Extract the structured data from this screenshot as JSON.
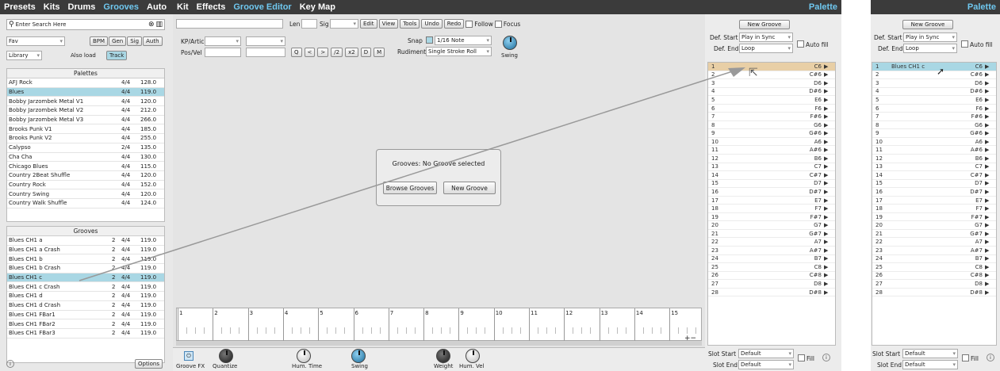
{
  "left_tabs": [
    "Presets",
    "Kits",
    "Drums",
    "Grooves",
    "Auto"
  ],
  "center_tabs": [
    "Kit",
    "Effects",
    "Groove Editor",
    "Key Map"
  ],
  "palette_title": "Palette",
  "search": {
    "placeholder": "Enter Search Here"
  },
  "filter": {
    "fav": "Fav",
    "bpm": "BPM",
    "gen": "Gen",
    "sig": "Sig",
    "auth": "Auth",
    "library": "Library",
    "also_load": "Also load",
    "track": "Track"
  },
  "palettes": {
    "title": "Palettes",
    "rows": [
      [
        "AFJ Rock",
        "4/4",
        "128.0"
      ],
      [
        "Blues",
        "4/4",
        "119.0"
      ],
      [
        "Bobby Jarzombek Metal V1",
        "4/4",
        "120.0"
      ],
      [
        "Bobby Jarzombek Metal V2",
        "4/4",
        "212.0"
      ],
      [
        "Bobby Jarzombek Metal V3",
        "4/4",
        "266.0"
      ],
      [
        "Brooks Punk V1",
        "4/4",
        "185.0"
      ],
      [
        "Brooks Punk V2",
        "4/4",
        "255.0"
      ],
      [
        "Calypso",
        "2/4",
        "135.0"
      ],
      [
        "Cha Cha",
        "4/4",
        "130.0"
      ],
      [
        "Chicago Blues",
        "4/4",
        "115.0"
      ],
      [
        "Country 2Beat Shuffle",
        "4/4",
        "120.0"
      ],
      [
        "Country Rock",
        "4/4",
        "152.0"
      ],
      [
        "Country Swing",
        "4/4",
        "120.0"
      ],
      [
        "Country Walk Shuffle",
        "4/4",
        "124.0"
      ]
    ]
  },
  "grooves": {
    "title": "Grooves",
    "rows": [
      [
        "Blues CH1 a",
        "2",
        "4/4",
        "119.0"
      ],
      [
        "Blues CH1 a Crash",
        "2",
        "4/4",
        "119.0"
      ],
      [
        "Blues CH1 b",
        "2",
        "4/4",
        "119.0"
      ],
      [
        "Blues CH1 b Crash",
        "2",
        "4/4",
        "119.0"
      ],
      [
        "Blues CH1 c",
        "2",
        "4/4",
        "119.0"
      ],
      [
        "Blues CH1 c Crash",
        "2",
        "4/4",
        "119.0"
      ],
      [
        "Blues CH1 d",
        "2",
        "4/4",
        "119.0"
      ],
      [
        "Blues CH1 d Crash",
        "2",
        "4/4",
        "119.0"
      ],
      [
        "Blues CH1 FBar1",
        "2",
        "4/4",
        "119.0"
      ],
      [
        "Blues CH1 FBar2",
        "2",
        "4/4",
        "119.0"
      ],
      [
        "Blues CH1 FBar3",
        "2",
        "4/4",
        "119.0"
      ]
    ]
  },
  "options": "Options",
  "editor": {
    "len": "Len",
    "sig": "Sig",
    "edit": "Edit",
    "view": "View",
    "tools": "Tools",
    "undo": "Undo",
    "redo": "Redo",
    "follow": "Follow",
    "focus": "Focus",
    "kp_artic": "KP/Artic",
    "pos_vel": "Pos/Vel",
    "q": "Q",
    "lt": "<",
    ">gt": ">",
    "div2": "/2",
    "x2": "x2",
    "d": "D",
    "m": "M",
    "snap": "Snap",
    "snap_value": "1/16 Note",
    "rudiment": "Rudiment",
    "rudiment_value": "Single Stroke Roll",
    "swing": "Swing"
  },
  "dialog": {
    "message": "Grooves: No Groove selected",
    "browse": "Browse Grooves",
    "new": "New Groove"
  },
  "ruler": [
    "1",
    "2",
    "3",
    "4",
    "5",
    "6",
    "7",
    "8",
    "9",
    "10",
    "11",
    "12",
    "13",
    "14",
    "15"
  ],
  "bottom_knobs": {
    "groove_fx": "Groove FX",
    "quantize": "Quantize",
    "hum_time": "Hum. Time",
    "swing": "Swing",
    "weight": "Weight",
    "hum_vel": "Hum. Vel"
  },
  "palette_panel": {
    "new_groove": "New Groove",
    "def_start": "Def. Start",
    "def_start_value": "Play in Sync",
    "def_end": "Def. End",
    "def_end_value": "Loop",
    "auto_fill": "Auto fill",
    "slot_start": "Slot Start",
    "slot_start_value": "Default",
    "slot_end": "Slot End",
    "slot_end_value": "Default",
    "fill": "Fill"
  },
  "slot_label_right": "Blues CH1 c",
  "notes": [
    "C6",
    "C#6",
    "D6",
    "D#6",
    "E6",
    "F6",
    "F#6",
    "G6",
    "G#6",
    "A6",
    "A#6",
    "B6",
    "C7",
    "C#7",
    "D7",
    "D#7",
    "E7",
    "F7",
    "F#7",
    "G7",
    "G#7",
    "A7",
    "A#7",
    "B7",
    "C8",
    "C#8",
    "D8",
    "D#8"
  ],
  "colors": {
    "accent": "#6fc8f0",
    "selected": "#a9d7e4",
    "drag_slot": "#e8cfa6"
  }
}
